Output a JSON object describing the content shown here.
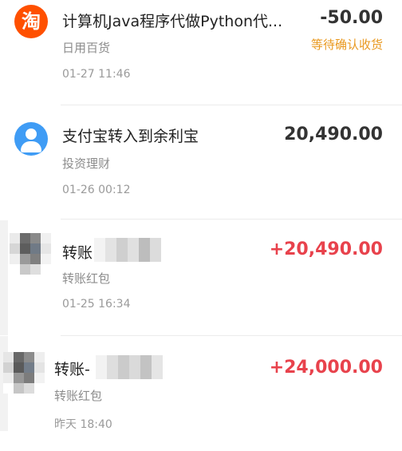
{
  "transactions": [
    {
      "title": "计算机Java程序代做Python代...",
      "category": "日用百货",
      "time": "01-27 11:46",
      "amount": "-50.00",
      "status": "等待确认收货",
      "icon": "taobao-icon",
      "icon_glyph": "淘"
    },
    {
      "title": "支付宝转入到余利宝",
      "category": "投资理财",
      "time": "01-26 00:12",
      "amount": "20,490.00",
      "icon": "user-icon"
    },
    {
      "title": "转账",
      "category": "转账红包",
      "time": "01-25 16:34",
      "amount": "+20,490.00",
      "icon": "blurred-avatar"
    },
    {
      "title": "转账-",
      "category": "转账红包",
      "time": "昨天 18:40",
      "amount": "+24,000.00",
      "icon": "blurred-avatar"
    }
  ],
  "colors": {
    "income": "#e8424c",
    "status": "#e99a22",
    "taobao": "#ff5000",
    "user_icon": "#3f9cf5"
  }
}
